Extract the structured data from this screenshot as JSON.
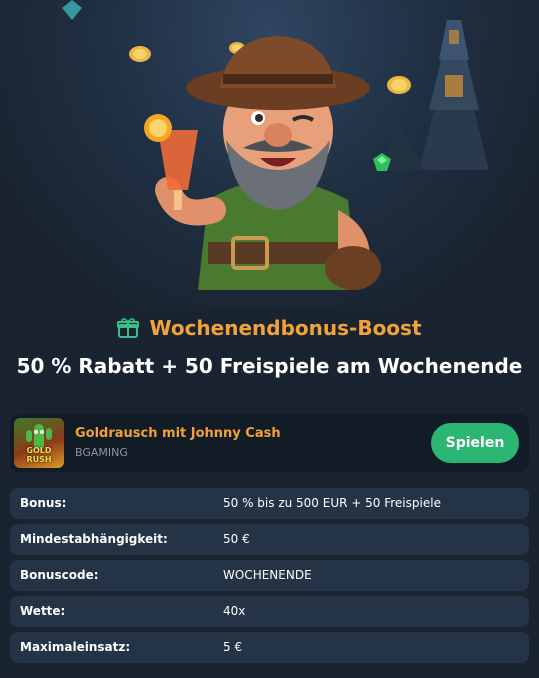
{
  "promo": {
    "title": "Wochenendbonus-Boost",
    "subtitle": "50 % Rabatt + 50 Freispiele am Wochenende"
  },
  "game": {
    "name": "Goldrausch mit Johnny Cash",
    "provider": "BGAMING",
    "thumb_text": "GOLD RUSH",
    "play_label": "Spielen"
  },
  "details": [
    {
      "label": "Bonus:",
      "value": "50 % bis zu 500 EUR + 50 Freispiele"
    },
    {
      "label": "Mindestabhängigkeit:",
      "value": "50 €"
    },
    {
      "label": "Bonuscode:",
      "value": "WOCHENENDE"
    },
    {
      "label": "Wette:",
      "value": "40x"
    },
    {
      "label": "Maximaleinsatz:",
      "value": "5 €"
    }
  ],
  "colors": {
    "background": "#1a2430",
    "accent_orange": "#f2a23a",
    "play_green": "#2bb673",
    "row_bg": "#243446",
    "card_bg": "#121c26",
    "gift_icon": "#36c08a"
  }
}
